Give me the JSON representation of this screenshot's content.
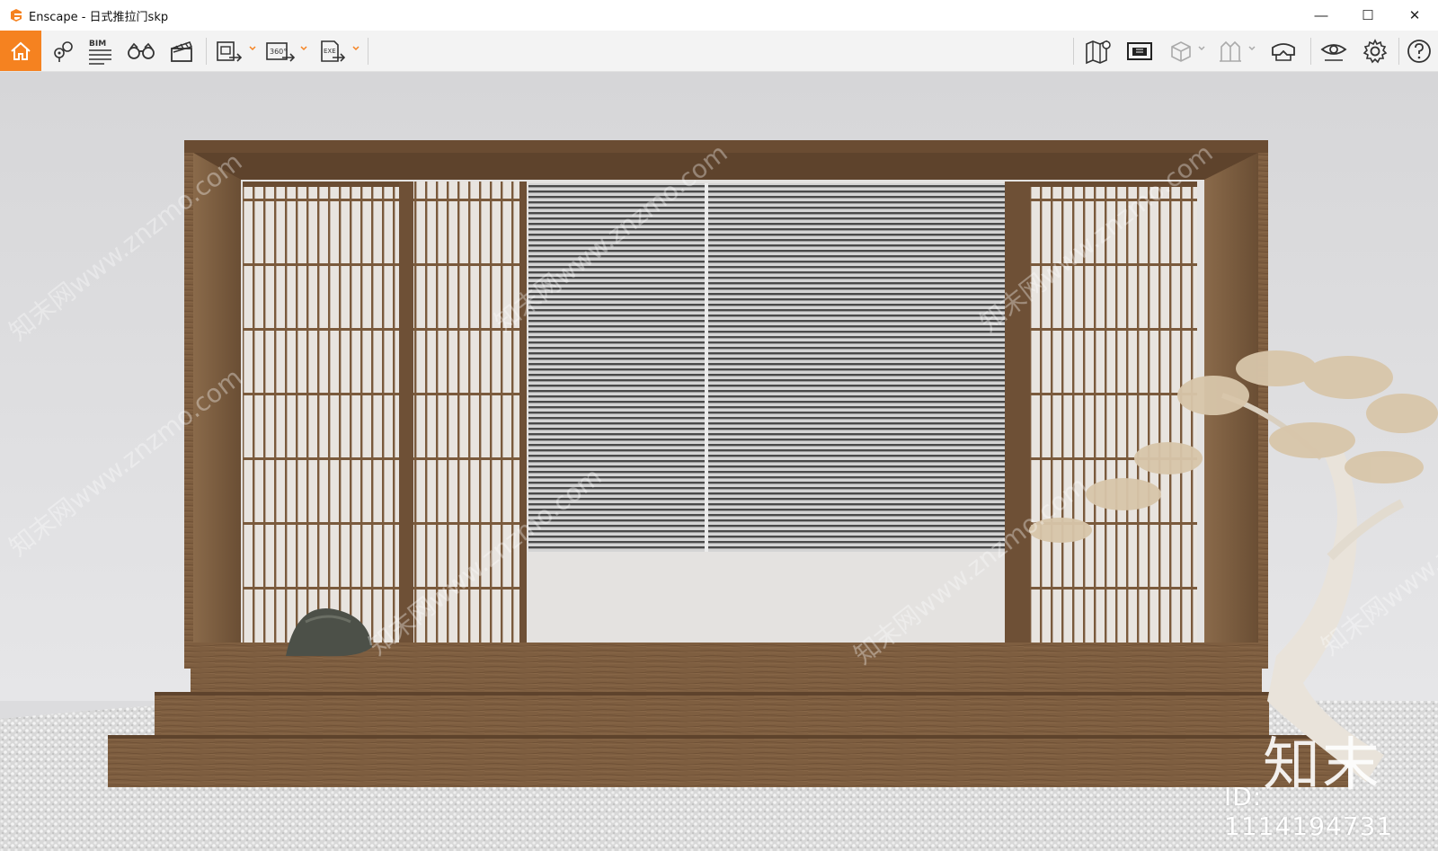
{
  "window": {
    "app_name": "Enscape",
    "title": "Enscape - 日式推拉门skp",
    "controls": {
      "minimize": "—",
      "maximize": "☐",
      "close": "✕"
    }
  },
  "toolbar": {
    "left_buttons": [
      {
        "name": "home-icon",
        "active": true
      },
      {
        "name": "views-icon"
      },
      {
        "name": "bim-icon",
        "label": "BIM"
      },
      {
        "name": "binoculars-icon"
      },
      {
        "name": "clapperboard-icon"
      },
      {
        "name": "export-image-icon",
        "dropdown": true
      },
      {
        "name": "export-panorama-icon",
        "label": "360°",
        "dropdown": true
      },
      {
        "name": "export-exe-icon",
        "label": "EXE",
        "dropdown": true
      }
    ],
    "right_buttons": [
      {
        "name": "map-icon"
      },
      {
        "name": "screen-icon"
      },
      {
        "name": "cube-icon",
        "dropdown": true,
        "disabled": true
      },
      {
        "name": "asset-library-icon",
        "dropdown": true,
        "disabled": true
      },
      {
        "name": "vr-headset-icon"
      },
      {
        "name": "eye-settings-icon"
      },
      {
        "name": "gear-icon"
      },
      {
        "name": "help-icon"
      }
    ],
    "accent_color": "#f58220"
  },
  "viewport": {
    "scene": "rendered Japanese sliding door pavilion",
    "watermark_text": "知末网www.znzmo.com",
    "logo_text": "知末",
    "id_text": "ID: 1114194731"
  }
}
